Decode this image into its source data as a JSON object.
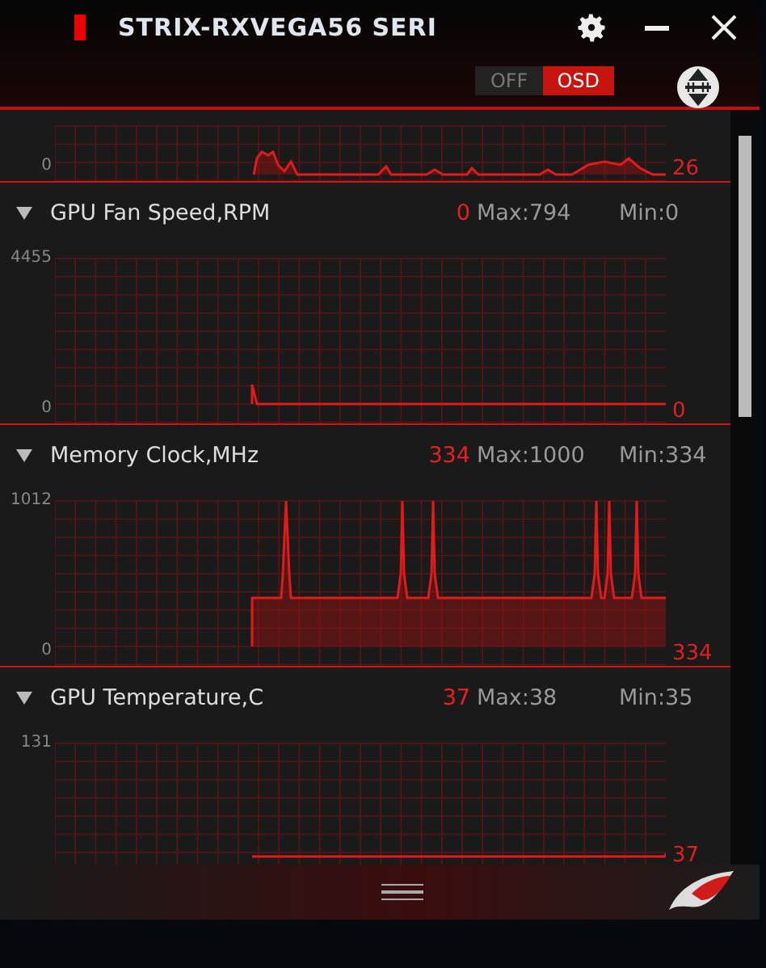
{
  "window": {
    "title": "STRIX-RXVEGA56 SERI"
  },
  "osd_toggle": [
    {
      "label": "OFF",
      "selected": false
    },
    {
      "label": "OSD",
      "selected": true
    }
  ],
  "monitors": [
    {
      "current": "26",
      "axis_min": "0"
    },
    {
      "title": "GPU Fan Speed,RPM",
      "expanded": true,
      "current": "0",
      "max": "Max:794",
      "min": "Min:0",
      "axis_max": "4455",
      "axis_min": "0",
      "current_label": "0"
    },
    {
      "title": "Memory Clock,MHz",
      "expanded": true,
      "current": "334",
      "max": "Max:1000",
      "min": "Min:334",
      "axis_max": "1012",
      "axis_min": "0",
      "current_label": "334"
    },
    {
      "title": "GPU Temperature,C",
      "expanded": true,
      "current": "37",
      "max": "Max:38",
      "min": "Min:35",
      "axis_max": "131",
      "current_label": "37"
    }
  ]
}
